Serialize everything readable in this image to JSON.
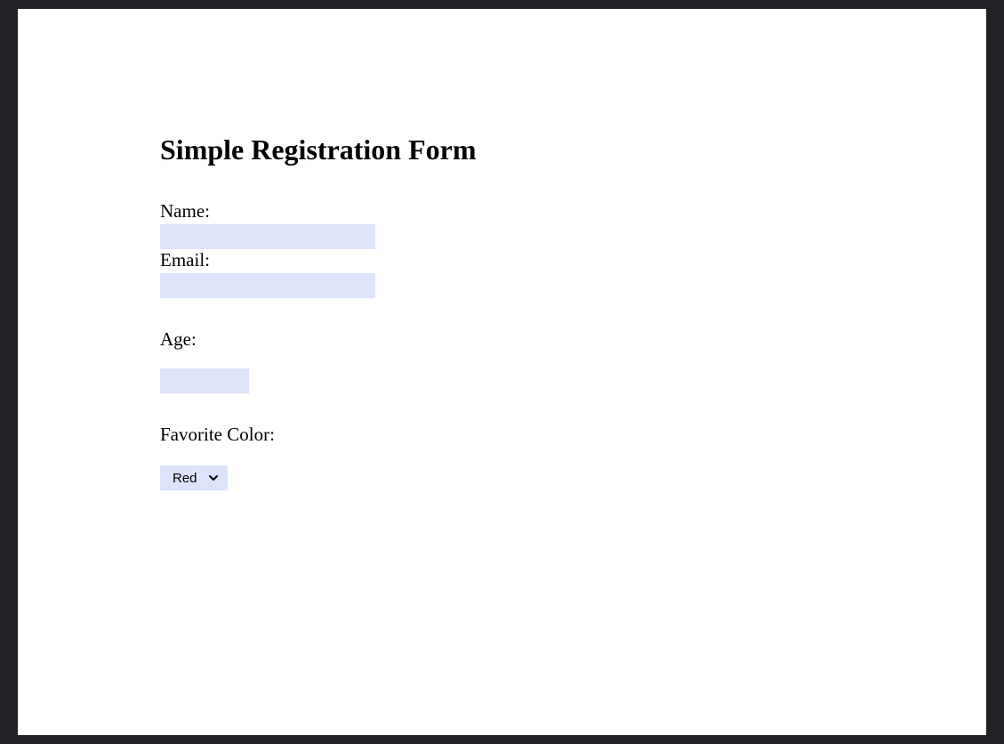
{
  "form": {
    "title": "Simple Registration Form",
    "name": {
      "label": "Name:",
      "value": ""
    },
    "email": {
      "label": "Email:",
      "value": ""
    },
    "age": {
      "label": "Age:",
      "value": ""
    },
    "color": {
      "label": "Favorite Color:",
      "selected": "Red"
    }
  }
}
